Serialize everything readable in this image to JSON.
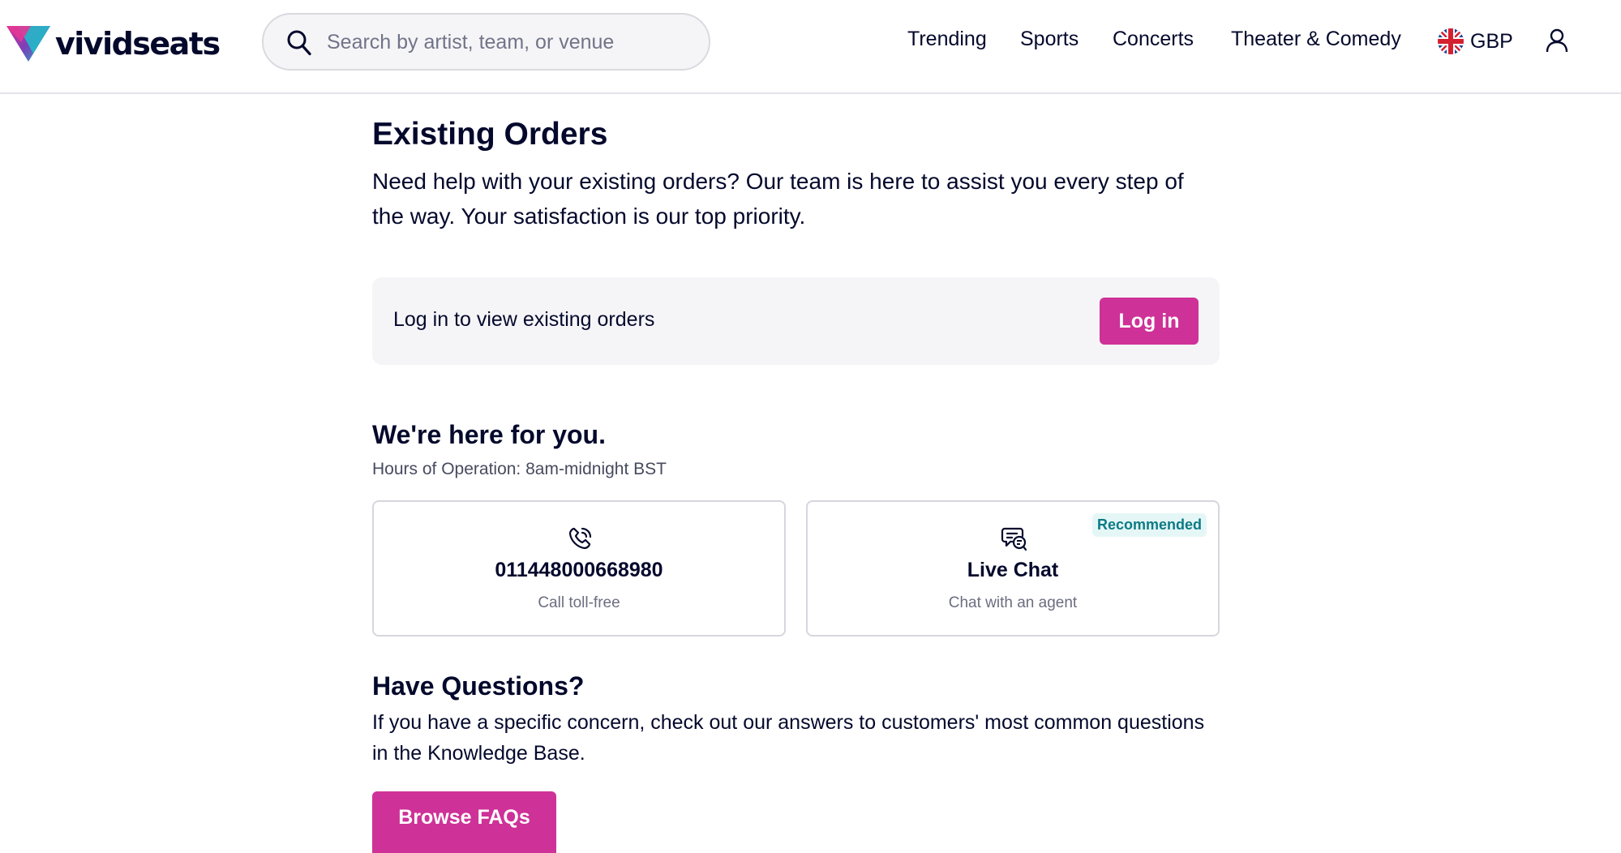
{
  "header": {
    "logo_text": "vividseats",
    "search_placeholder": "Search by artist, team, or venue",
    "nav": [
      "Trending",
      "Sports",
      "Concerts",
      "Theater & Comedy"
    ],
    "currency": "GBP",
    "icons": {
      "search": "search-icon",
      "flag": "uk-flag-icon",
      "account": "user-icon"
    }
  },
  "main": {
    "title": "Existing Orders",
    "intro": "Need help with your existing orders? Our team is here to assist you every step of the way. Your satisfaction is our top priority.",
    "login_card": {
      "text": "Log in to view existing orders",
      "button_label": "Log in"
    },
    "support": {
      "title": "We're here for you.",
      "hours": "Hours of Operation: 8am-midnight BST",
      "phone_card": {
        "title": "011448000668980",
        "subtitle": "Call toll-free",
        "icon": "phone-icon"
      },
      "chat_card": {
        "title": "Live Chat",
        "subtitle": "Chat with an agent",
        "badge": "Recommended",
        "icon": "chat-icon"
      }
    },
    "questions": {
      "title": "Have Questions?",
      "text": "If you have a specific concern, check out our answers to customers' most common questions in the Knowledge Base.",
      "button_label": "Browse FAQs"
    }
  },
  "colors": {
    "brand_pink": "#ce3197",
    "text_dark": "#04092c",
    "badge_bg": "#e5f6f6",
    "badge_text": "#0c7b85",
    "card_bg": "#f5f5f8"
  }
}
